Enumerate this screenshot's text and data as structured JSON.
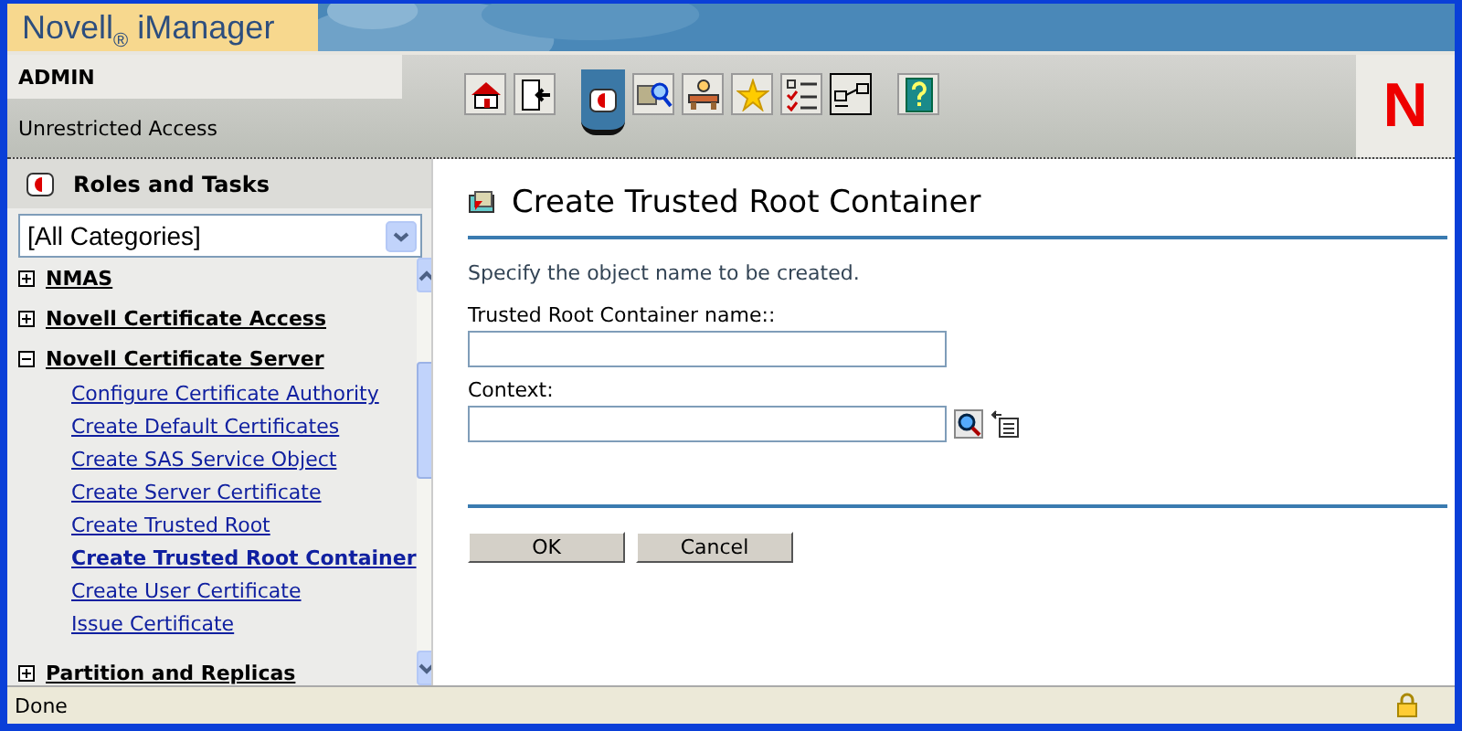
{
  "banner": {
    "logo": "Novell$_{®}$ iManager"
  },
  "user": {
    "name": "ADMIN",
    "access": "Unrestricted Access"
  },
  "toolbar": [
    {
      "kind": "home",
      "selected": false
    },
    {
      "kind": "exit",
      "selected": false
    },
    {
      "kind": "roles",
      "selected": true
    },
    {
      "kind": "view",
      "selected": false
    },
    {
      "kind": "configure",
      "selected": false
    },
    {
      "kind": "favorites",
      "selected": false
    },
    {
      "kind": "tasks",
      "selected": false
    },
    {
      "kind": "network",
      "selected": true
    },
    {
      "kind": "help",
      "selected": false
    }
  ],
  "brand": "N",
  "sidebar": {
    "title": "Roles and Tasks",
    "category": "[All Categories]",
    "groups": [
      {
        "label": "NMAS",
        "expanded": false
      },
      {
        "label": "Novell Certificate Access",
        "expanded": false
      },
      {
        "label": "Novell Certificate Server",
        "expanded": true,
        "children": [
          {
            "label": "Configure Certificate Authority",
            "selected": false
          },
          {
            "label": "Create Default Certificates",
            "selected": false
          },
          {
            "label": "Create SAS Service Object",
            "selected": false
          },
          {
            "label": "Create Server Certificate",
            "selected": false
          },
          {
            "label": "Create Trusted Root",
            "selected": false
          },
          {
            "label": "Create Trusted Root Container",
            "selected": true
          },
          {
            "label": "Create User Certificate",
            "selected": false
          },
          {
            "label": "Issue Certificate",
            "selected": false
          }
        ]
      },
      {
        "label": "Partition and Replicas",
        "expanded": false
      }
    ]
  },
  "content": {
    "title": "Create Trusted Root Container",
    "instruction": "Specify the object name to be created.",
    "fields": [
      {
        "label": "Trusted Root Container name::",
        "kind": "text"
      },
      {
        "label": "Context:",
        "kind": "browse"
      }
    ],
    "buttons": [
      "OK",
      "Cancel"
    ]
  },
  "status_bar": {
    "text": "Done"
  }
}
